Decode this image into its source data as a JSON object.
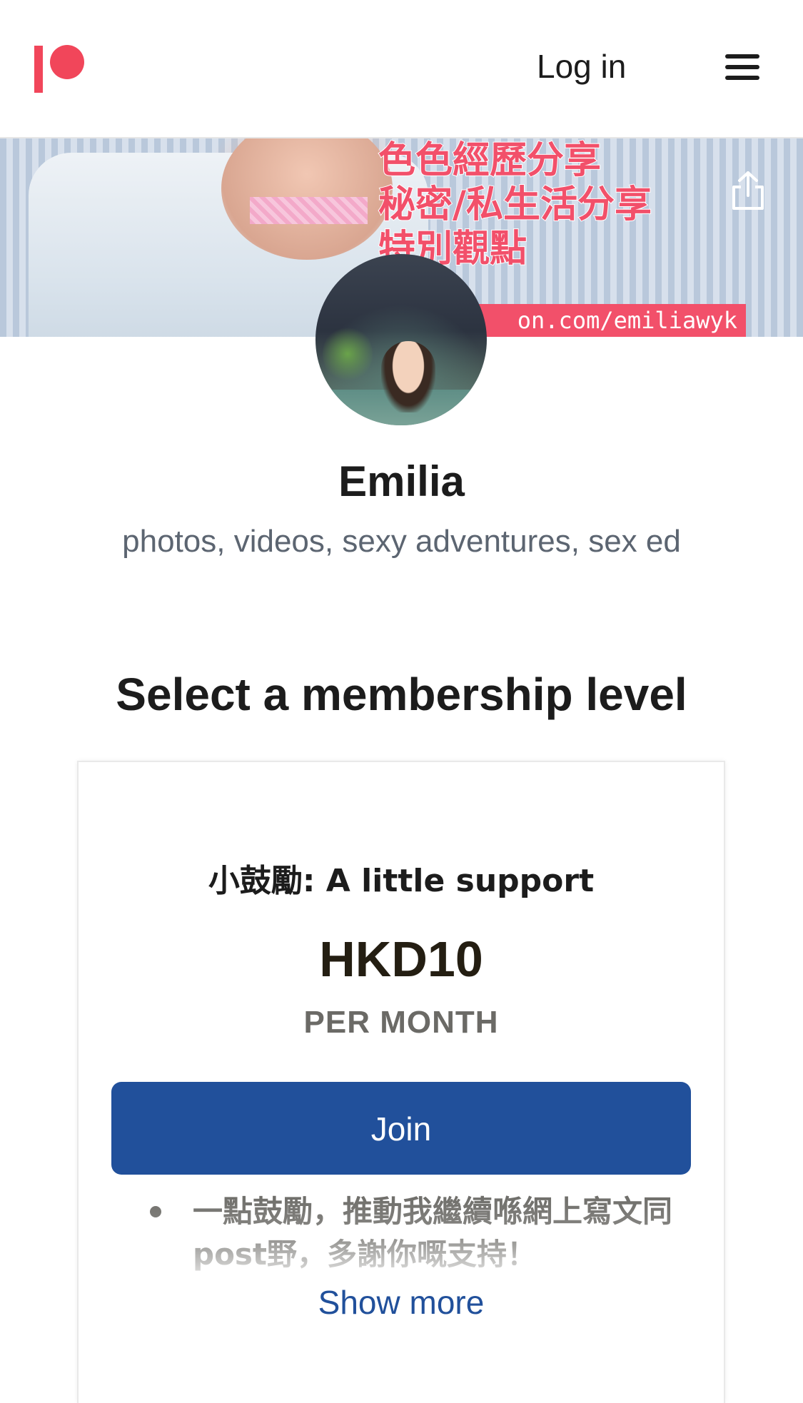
{
  "header": {
    "logo": "patreon-logo",
    "login_label": "Log in",
    "menu_icon": "hamburger-menu-icon"
  },
  "banner": {
    "promo_lines": [
      "色色經歷分享",
      "秘密/私生活分享",
      "特別觀點"
    ],
    "url_text": "on.com/emiliawyk",
    "share_icon": "share-icon"
  },
  "creator": {
    "name": "Emilia",
    "tagline": "photos, videos, sexy adventures, sex ed"
  },
  "membership": {
    "section_title": "Select a membership level",
    "tiers": [
      {
        "name": "小鼓勵: A little support",
        "price": "HKD10",
        "period": "PER MONTH",
        "join_label": "Join",
        "benefits": [
          "一點鼓勵，推動我繼續喺網上寫文同post野，多謝你嘅支持！"
        ],
        "show_more_label": "Show more"
      }
    ]
  },
  "colors": {
    "brand": "#f1465a",
    "join_button": "#21509b",
    "link": "#21509b"
  }
}
